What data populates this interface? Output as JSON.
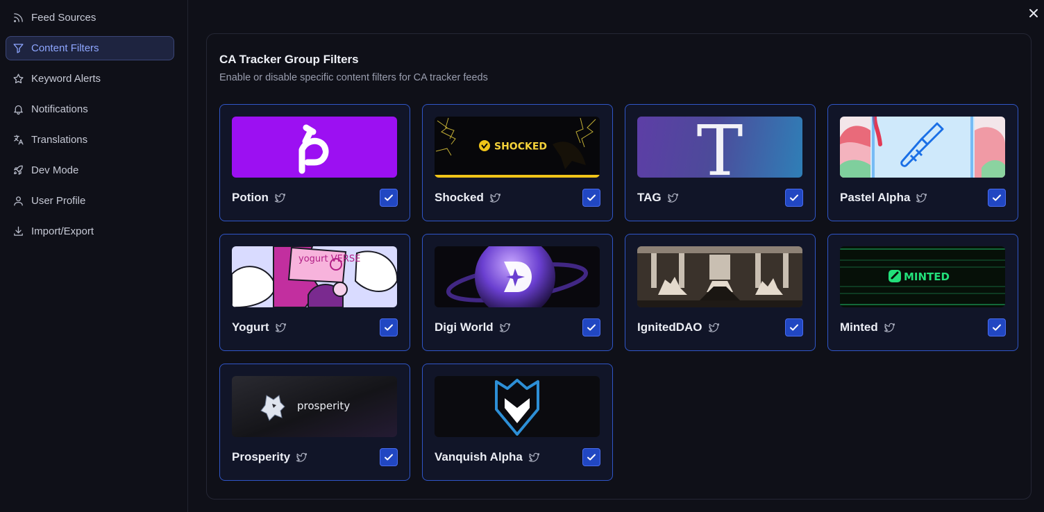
{
  "sidebar": {
    "items": [
      {
        "label": "Feed Sources",
        "icon": "rss-icon"
      },
      {
        "label": "Content Filters",
        "icon": "filter-icon",
        "active": true
      },
      {
        "label": "Keyword Alerts",
        "icon": "star-icon"
      },
      {
        "label": "Notifications",
        "icon": "bell-icon"
      },
      {
        "label": "Translations",
        "icon": "translate-icon"
      },
      {
        "label": "Dev Mode",
        "icon": "rocket-icon"
      },
      {
        "label": "User Profile",
        "icon": "user-icon"
      },
      {
        "label": "Import/Export",
        "icon": "download-icon"
      }
    ]
  },
  "panel": {
    "title": "CA Tracker Group Filters",
    "subtitle": "Enable or disable specific content filters for CA tracker feeds"
  },
  "groups": [
    {
      "name": "Potion",
      "checked": true,
      "social_icon": "twitter-icon"
    },
    {
      "name": "Shocked",
      "checked": true,
      "social_icon": "twitter-icon",
      "logo_text": "SHOCKED"
    },
    {
      "name": "TAG",
      "checked": true,
      "social_icon": "twitter-icon",
      "logo_text": "T"
    },
    {
      "name": "Pastel Alpha",
      "checked": true,
      "social_icon": "twitter-icon"
    },
    {
      "name": "Yogurt",
      "checked": true,
      "social_icon": "twitter-icon",
      "logo_text": "yogurt VERSE"
    },
    {
      "name": "Digi World",
      "checked": true,
      "social_icon": "twitter-icon"
    },
    {
      "name": "IgnitedDAO",
      "checked": true,
      "social_icon": "twitter-icon"
    },
    {
      "name": "Minted",
      "checked": true,
      "social_icon": "twitter-icon",
      "logo_text": "MINTED"
    },
    {
      "name": "Prosperity",
      "checked": true,
      "social_icon": "twitter-icon",
      "logo_text": "prosperity"
    },
    {
      "name": "Vanquish Alpha",
      "checked": true,
      "social_icon": "twitter-icon"
    }
  ],
  "colors": {
    "accent": "#8ea6ff",
    "card_border": "#3056c8",
    "checkbox": "#2147c2",
    "background": "#0f1018"
  }
}
